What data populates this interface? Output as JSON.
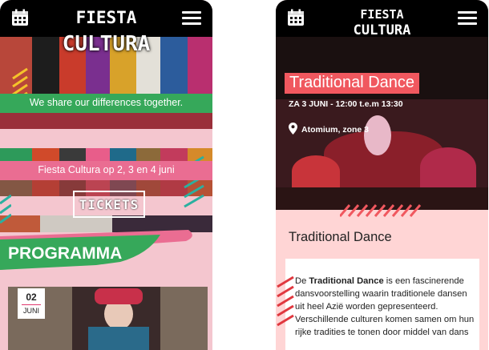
{
  "left_phone": {
    "logo_line1": "FIESTA",
    "logo_line2": "CULTURA",
    "tagline": "We share our differences together.",
    "dates_banner": "Fiesta Cultura op 2, 3 en 4 juni",
    "tickets_label": "TICKETS",
    "section_title": "PROGRAMMA",
    "event_card": {
      "day": "02",
      "month": "JUNI"
    }
  },
  "right_phone": {
    "logo_line1": "FIESTA",
    "logo_line2": "CULTURA",
    "hero_title": "Traditional Dance",
    "hero_datetime": "ZA 3 JUNI - 12:00 t.e.m 13:30",
    "hero_location": "Atomium, zone 3",
    "event_heading": "Traditional Dance",
    "description": {
      "intro": "De ",
      "highlight": "Traditional Dance",
      "rest": " is een fascinerende dansvoorstelling waarin traditionele dansen uit heel Azië worden gepresenteerd. Verschillende culturen komen samen om hun rijke tradities te tonen door middel van dans"
    }
  },
  "icons": [
    "calendar-icon",
    "menu-icon",
    "location-pin-icon"
  ],
  "colors": {
    "green": "#36a85a",
    "pink": "#ea6d92",
    "coral": "#f0585f",
    "panel": "#ffd5d5",
    "black": "#000000"
  }
}
